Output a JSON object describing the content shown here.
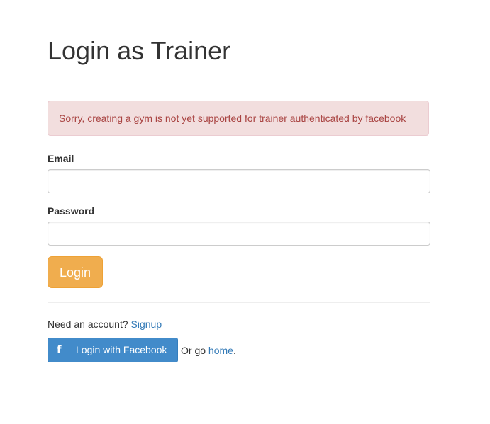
{
  "page": {
    "title": "Login as Trainer"
  },
  "alert": {
    "message": "Sorry, creating a gym is not yet supported for trainer authenticated by facebook",
    "colors": {
      "background": "#f2dede",
      "border": "#ebccd1",
      "text": "#a94442"
    }
  },
  "form": {
    "email": {
      "label": "Email",
      "value": "",
      "placeholder": ""
    },
    "password": {
      "label": "Password",
      "value": "",
      "placeholder": ""
    },
    "login_button": {
      "label": "Login",
      "color": "#f0ad4e"
    }
  },
  "signup": {
    "prompt": "Need an account? ",
    "link_label": "Signup"
  },
  "facebook": {
    "icon": "facebook-icon",
    "icon_glyph": "f",
    "label": "Login with Facebook",
    "color": "#428bca"
  },
  "home": {
    "prefix": "Or go ",
    "link_label": "home",
    "suffix": "."
  },
  "colors": {
    "link": "#337ab7",
    "text": "#333333"
  }
}
